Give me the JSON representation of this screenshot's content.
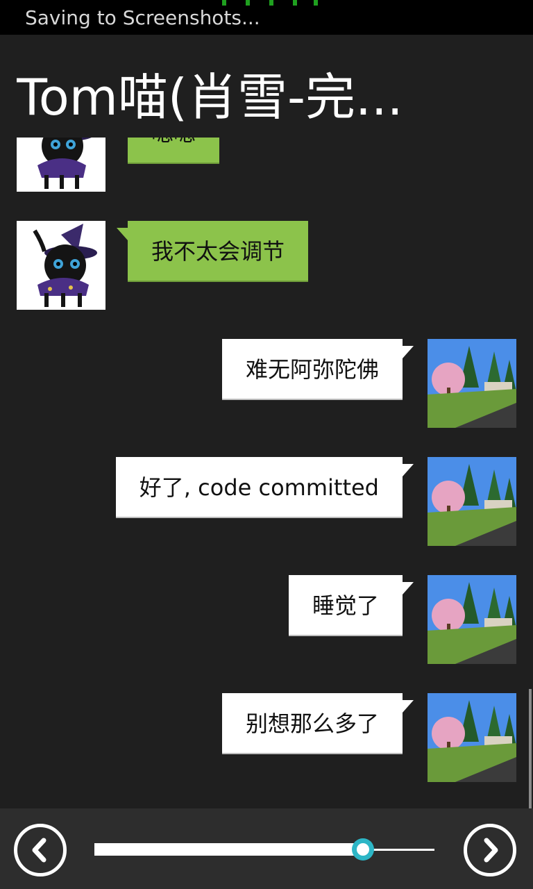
{
  "status_bar": {
    "text": "Saving to Screenshots..."
  },
  "header": {
    "title": "Tom喵(肖雪-完..."
  },
  "messages": [
    {
      "side": "left",
      "avatar": "black-cat-witch-avatar",
      "text": "嗯嗯"
    },
    {
      "side": "left",
      "avatar": "black-cat-witch-avatar",
      "text": "我不太会调节"
    },
    {
      "side": "right",
      "avatar": "landscape-tree-avatar",
      "text": "难无阿弥陀佛"
    },
    {
      "side": "right",
      "avatar": "landscape-tree-avatar",
      "text": "好了, code committed"
    },
    {
      "side": "right",
      "avatar": "landscape-tree-avatar",
      "text": "睡觉了"
    },
    {
      "side": "right",
      "avatar": "landscape-tree-avatar",
      "text": "别想那么多了"
    }
  ],
  "bottom_bar": {
    "prev_icon": "chevron-left-icon",
    "next_icon": "chevron-right-icon",
    "slider_value": 0.79
  },
  "colors": {
    "background": "#1f1f1f",
    "incoming_bubble": "#8cc34b",
    "outgoing_bubble": "#ffffff",
    "slider_accent": "#2db6c6"
  }
}
